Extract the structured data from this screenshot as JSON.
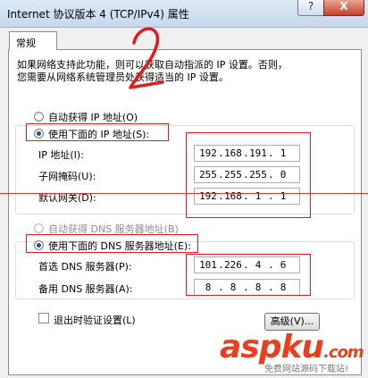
{
  "window": {
    "title": "Internet 协议版本 4 (TCP/IPv4) 属性",
    "help_label": "?",
    "close_label": "X"
  },
  "tab": {
    "label": "常规"
  },
  "description": {
    "line1": "如果网络支持此功能，则可以获取自动指派的 IP 设置。否则，",
    "line2": "您需要从网络系统管理员处获得适当的 IP 设置。"
  },
  "ip_section": {
    "auto_option": "自动获得 IP 地址(O)",
    "manual_option": "使用下面的 IP 地址(S):",
    "selected": "manual",
    "fields": [
      {
        "label": "IP 地址(I):",
        "octets": [
          "192",
          "168",
          "191",
          "1"
        ]
      },
      {
        "label": "子网掩码(U):",
        "octets": [
          "255",
          "255",
          "255",
          "0"
        ]
      },
      {
        "label": "默认网关(D):",
        "octets": [
          "192",
          "168",
          "1",
          "1"
        ]
      }
    ]
  },
  "dns_section": {
    "auto_option": "自动获得 DNS 服务器地址(B)",
    "manual_option": "使用下面的 DNS 服务器地址(E):",
    "selected": "manual",
    "fields": [
      {
        "label": "首选 DNS 服务器(P):",
        "octets": [
          "101",
          "226",
          "4",
          "6"
        ]
      },
      {
        "label": "备用 DNS 服务器(A):",
        "octets": [
          "8",
          "8",
          "8",
          "8"
        ]
      }
    ]
  },
  "validate_on_exit": {
    "label": "退出时验证设置(L)",
    "checked": false
  },
  "advanced_button": {
    "label": "高级(V)..."
  },
  "annotation": {
    "handwritten_number": "2"
  },
  "watermark": {
    "brand": "aspku",
    "brand_suffix": ".com",
    "tagline": "免费网站源码下载站!"
  },
  "colors": {
    "annotation_red": "#e01c1c",
    "watermark_orange": "#e8401e",
    "watermark_blue": "#1e5fd0"
  }
}
